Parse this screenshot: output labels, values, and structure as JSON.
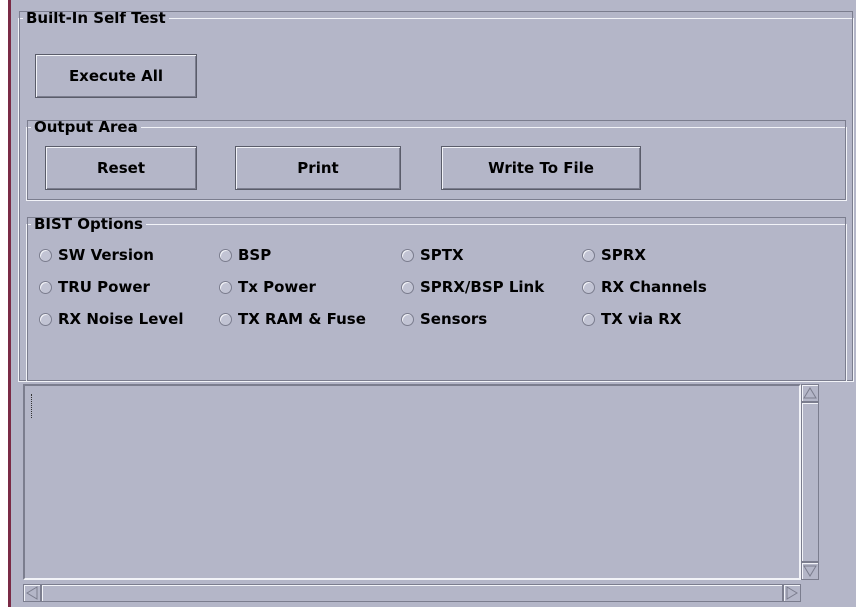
{
  "bist": {
    "title": "Built-In Self Test",
    "execute_all_label": "Execute All"
  },
  "output_area": {
    "title": "Output Area",
    "reset_label": "Reset",
    "print_label": "Print",
    "write_to_file_label": "Write To File"
  },
  "bist_options": {
    "title": "BIST Options",
    "options": [
      "SW Version",
      "BSP",
      "SPTX",
      "SPRX",
      "TRU Power",
      "Tx Power",
      "SPRX/BSP Link",
      "RX Channels",
      "RX Noise Level",
      "TX RAM & Fuse",
      "Sensors",
      "TX via RX"
    ],
    "selected": []
  },
  "output_text": "",
  "colors": {
    "background": "#b4b6c8",
    "highlight": "#f2f3f8",
    "shadow": "#7b7d8e",
    "window_edge": "#7a2a45"
  }
}
